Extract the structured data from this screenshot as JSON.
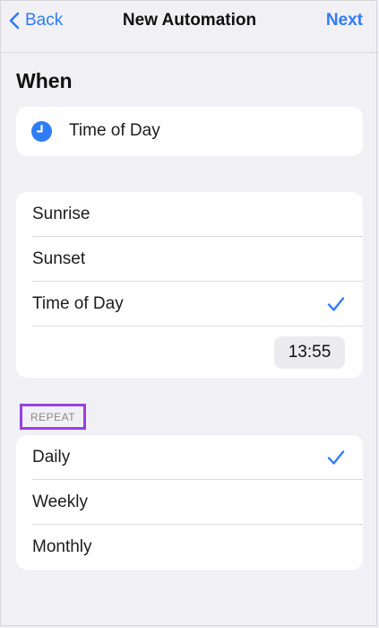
{
  "nav": {
    "back_label": "Back",
    "title": "New Automation",
    "next_label": "Next"
  },
  "section_heading": "When",
  "trigger": {
    "label": "Time of Day",
    "icon": "clock-icon"
  },
  "options": {
    "items": [
      {
        "label": "Sunrise",
        "selected": false
      },
      {
        "label": "Sunset",
        "selected": false
      },
      {
        "label": "Time of Day",
        "selected": true
      }
    ],
    "time_value": "13:55"
  },
  "repeat": {
    "header": "REPEAT",
    "items": [
      {
        "label": "Daily",
        "selected": true
      },
      {
        "label": "Weekly",
        "selected": false
      },
      {
        "label": "Monthly",
        "selected": false
      }
    ]
  },
  "colors": {
    "accent": "#2f7cf6",
    "highlight_border": "#9b3fe0",
    "background": "#f0f0f5"
  }
}
